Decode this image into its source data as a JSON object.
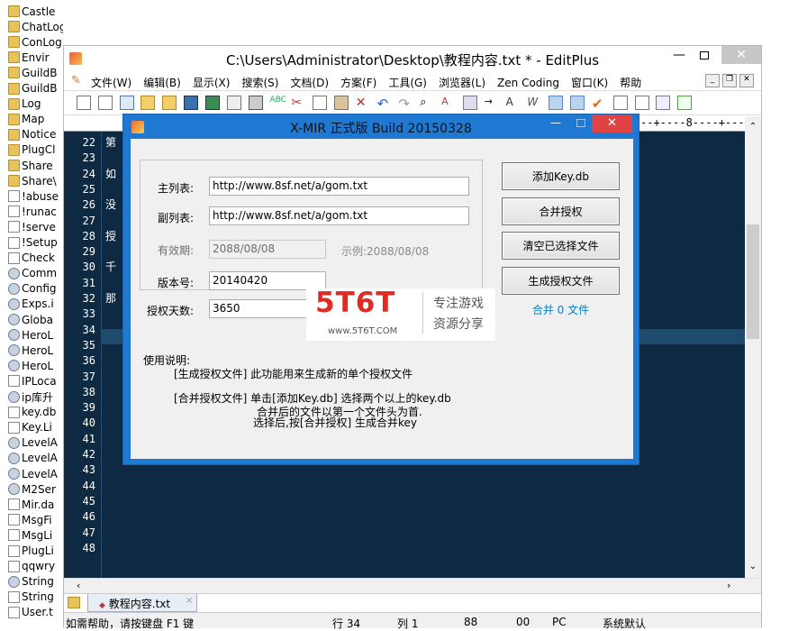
{
  "files": [
    {
      "name": "Castle",
      "icon": "folder-icon"
    },
    {
      "name": "ChatLog",
      "icon": "folder-icon"
    },
    {
      "name": "ConLog",
      "icon": "folder-icon"
    },
    {
      "name": "Envir",
      "icon": "folder-icon"
    },
    {
      "name": "GuildB",
      "icon": "folder-icon"
    },
    {
      "name": "GuildB",
      "icon": "folder-icon"
    },
    {
      "name": "Log",
      "icon": "folder-icon"
    },
    {
      "name": "Map",
      "icon": "folder-icon"
    },
    {
      "name": "Notice",
      "icon": "folder-icon"
    },
    {
      "name": "PlugCl",
      "icon": "folder-icon"
    },
    {
      "name": "Share",
      "icon": "folder-icon"
    },
    {
      "name": "Share\\",
      "icon": "folder-icon"
    },
    {
      "name": "!abuse",
      "icon": "file-icon"
    },
    {
      "name": "!runac",
      "icon": "file-icon"
    },
    {
      "name": "!serve",
      "icon": "file-icon"
    },
    {
      "name": "!Setup",
      "icon": "file-icon"
    },
    {
      "name": "Check",
      "icon": "file-icon"
    },
    {
      "name": "Comm",
      "icon": "gear-file-icon"
    },
    {
      "name": "Config",
      "icon": "gear-file-icon"
    },
    {
      "name": "Exps.i",
      "icon": "gear-file-icon"
    },
    {
      "name": "Globa",
      "icon": "gear-file-icon"
    },
    {
      "name": "HeroL",
      "icon": "gear-file-icon"
    },
    {
      "name": "HeroL",
      "icon": "gear-file-icon"
    },
    {
      "name": "HeroL",
      "icon": "gear-file-icon"
    },
    {
      "name": "IPLoca",
      "icon": "file-icon"
    },
    {
      "name": "ip库升",
      "icon": "app-icon"
    },
    {
      "name": "key.db",
      "icon": "file-icon"
    },
    {
      "name": "Key.Li",
      "icon": "file-icon"
    },
    {
      "name": "LevelA",
      "icon": "gear-file-icon"
    },
    {
      "name": "LevelA",
      "icon": "gear-file-icon"
    },
    {
      "name": "LevelA",
      "icon": "gear-file-icon"
    },
    {
      "name": "M2Ser",
      "icon": "app-icon"
    },
    {
      "name": "Mir.da",
      "icon": "file-icon"
    },
    {
      "name": "MsgFi",
      "icon": "file-icon"
    },
    {
      "name": "MsgLi",
      "icon": "file-icon"
    },
    {
      "name": "PlugLi",
      "icon": "file-icon"
    },
    {
      "name": "qqwry",
      "icon": "file-icon"
    },
    {
      "name": "String",
      "icon": "gear-file-icon"
    },
    {
      "name": "String",
      "icon": "file-icon"
    },
    {
      "name": "User.t",
      "icon": "file-icon"
    }
  ],
  "editplus": {
    "title": "C:\\Users\\Administrator\\Desktop\\教程内容.txt * - EditPlus",
    "menu": [
      "文件(W)",
      "编辑(B)",
      "显示(X)",
      "搜索(S)",
      "文档(D)",
      "方案(F)",
      "工具(G)",
      "浏览器(L)",
      "Zen Coding",
      "窗口(K)",
      "帮助"
    ],
    "ruler": "--+----8----+---",
    "lines": [
      {
        "n": "22",
        "t": "第"
      },
      {
        "n": "23",
        "t": ""
      },
      {
        "n": "24",
        "t": "如"
      },
      {
        "n": "25",
        "t": ""
      },
      {
        "n": "26",
        "t": "没"
      },
      {
        "n": "27",
        "t": ""
      },
      {
        "n": "28",
        "t": "授"
      },
      {
        "n": "29",
        "t": ""
      },
      {
        "n": "30",
        "t": "千"
      },
      {
        "n": "31",
        "t": ""
      },
      {
        "n": "32",
        "t": "那"
      },
      {
        "n": "33",
        "t": ""
      },
      {
        "n": "34",
        "t": ""
      },
      {
        "n": "35",
        "t": ""
      },
      {
        "n": "36",
        "t": ""
      },
      {
        "n": "37",
        "t": ""
      },
      {
        "n": "38",
        "t": ""
      },
      {
        "n": "39",
        "t": ""
      },
      {
        "n": "40",
        "t": ""
      },
      {
        "n": "41",
        "t": ""
      },
      {
        "n": "42",
        "t": ""
      },
      {
        "n": "43",
        "t": ""
      },
      {
        "n": "44",
        "t": ""
      },
      {
        "n": "45",
        "t": ""
      },
      {
        "n": "46",
        "t": ""
      },
      {
        "n": "47",
        "t": ""
      },
      {
        "n": "48",
        "t": ""
      }
    ],
    "tab": "教程内容.txt",
    "status": {
      "help": "如需帮助，请按键盘 F1 键",
      "row": "行 34",
      "col": "列 1",
      "c1": "88",
      "c2": "00",
      "os": "PC",
      "enc": "系统默认"
    }
  },
  "dialog": {
    "title": "X-MIR 正式版 Build 20150328",
    "main_list_label": "主列表:",
    "main_list_value": "http://www.8sf.net/a/gom.txt",
    "sub_list_label": "副列表:",
    "sub_list_value": "http://www.8sf.net/a/gom.txt",
    "expire_label": "有效期:",
    "expire_value": "2088/08/08",
    "expire_example": "示例:2088/08/08",
    "version_label": "版本号:",
    "version_value": "20140420",
    "days_label": "授权天数:",
    "days_value": "3650",
    "btn_add": "添加Key.db",
    "btn_merge": "合并授权",
    "btn_clear": "清空已选择文件",
    "btn_generate": "生成授权文件",
    "merge_count": "合并 0 文件",
    "usage_title": "使用说明:",
    "usage_1": "[生成授权文件] 此功能用来生成新的单个授权文件",
    "usage_2": "[合并授权文件] 单击[添加Key.db] 选择两个以上的key.db",
    "usage_3": "合并后的文件以第一个文件头为首.",
    "usage_4": "选择后,按[合并授权] 生成合并key"
  },
  "watermark": {
    "logo": "5T6T",
    "site": "www.5T6T.COM",
    "slogan1": "专注游戏",
    "slogan2": "资源分享"
  },
  "colors": {
    "editor_bg": "#0e2a42",
    "dialog_border": "#1f78d1",
    "close_red": "#e04343",
    "highlight_line": "#1e4a6e"
  }
}
